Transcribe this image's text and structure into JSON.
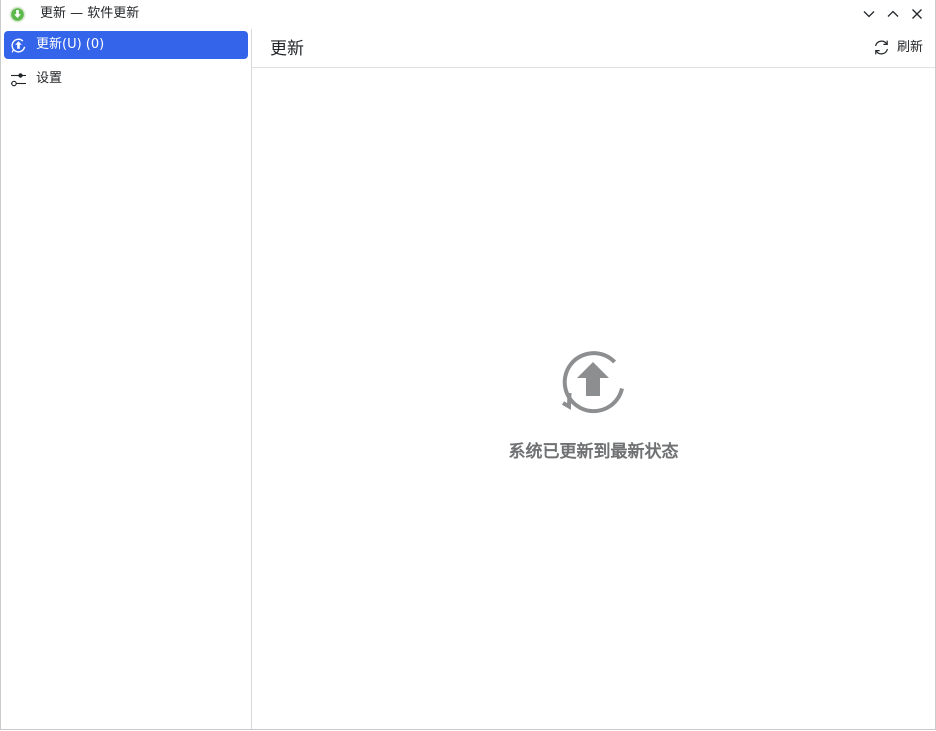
{
  "window": {
    "title": "更新 — 软件更新",
    "app_icon": "download-arrow-icon",
    "controls": {
      "minimize": "chevron-down-icon",
      "maximize": "chevron-up-icon",
      "close": "close-icon"
    }
  },
  "sidebar": {
    "items": [
      {
        "label": "更新(U) (0)",
        "icon": "update-arrow-circle-icon",
        "active": true
      },
      {
        "label": "设置",
        "icon": "settings-sliders-icon",
        "active": false
      }
    ]
  },
  "main": {
    "title": "更新",
    "refresh_label": "刷新",
    "refresh_icon": "refresh-icon",
    "status_icon": "update-arrow-circle-icon",
    "status_message": "系统已更新到最新状态"
  },
  "colors": {
    "accent": "#3464ea",
    "app_icon_green": "#5cb84a",
    "status_gray": "#8c8e90",
    "text": "#232629"
  }
}
